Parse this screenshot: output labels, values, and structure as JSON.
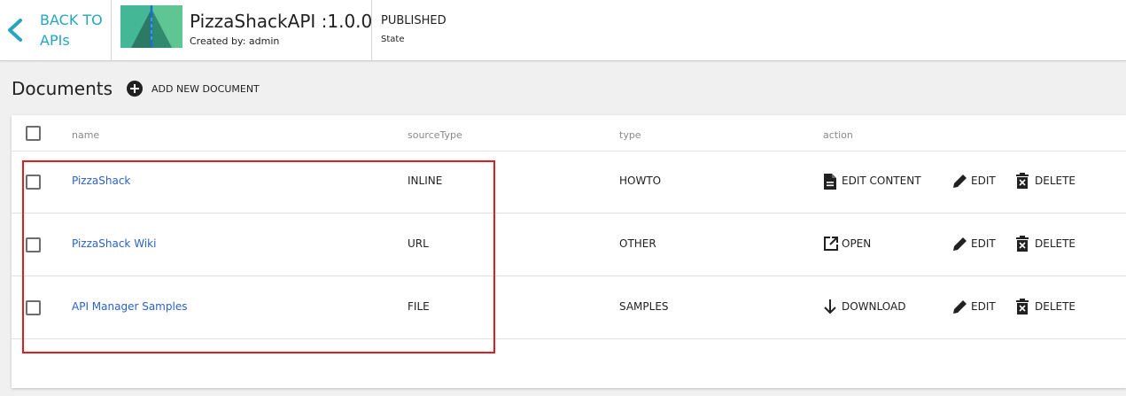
{
  "header": {
    "back_label": "BACK TO\nAPIs",
    "api_title": "PizzaShackAPI :1.0.0",
    "created_by": "Created by: admin",
    "state_value": "PUBLISHED",
    "state_label": "State"
  },
  "documents": {
    "title": "Documents",
    "add_label": "ADD NEW DOCUMENT"
  },
  "table": {
    "columns": [
      "name",
      "sourceType",
      "type",
      "action"
    ],
    "rows": [
      {
        "name": "PizzaShack",
        "sourceType": "INLINE",
        "type": "HOWTO",
        "main_action": "EDIT CONTENT",
        "main_icon": "file-document-icon",
        "edit": "EDIT",
        "delete": "DELETE"
      },
      {
        "name": "PizzaShack Wiki",
        "sourceType": "URL",
        "type": "OTHER",
        "main_action": "OPEN",
        "main_icon": "open-in-new-icon",
        "edit": "EDIT",
        "delete": "DELETE"
      },
      {
        "name": "API Manager Samples",
        "sourceType": "FILE",
        "type": "SAMPLES",
        "main_action": "DOWNLOAD",
        "main_icon": "arrow-down-icon",
        "edit": "EDIT",
        "delete": "DELETE"
      }
    ]
  },
  "colors": {
    "accent": "#26a6bd",
    "link": "#2a62c9",
    "highlight_box": "#e11d1d",
    "thumbnail": "#44b796"
  }
}
